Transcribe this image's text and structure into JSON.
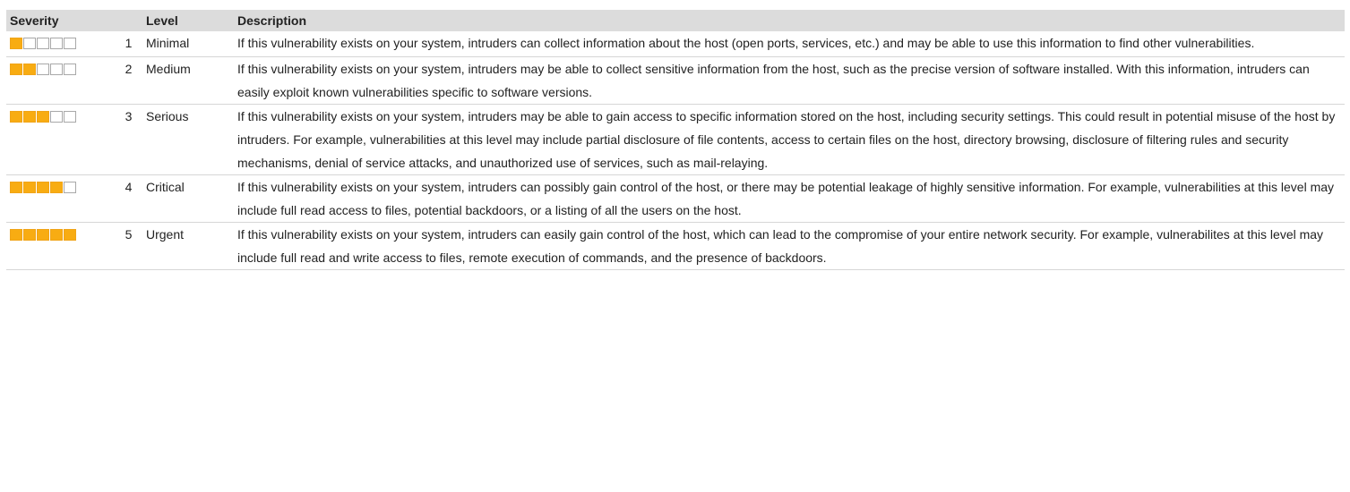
{
  "headers": {
    "severity": "Severity",
    "level": "Level",
    "description": "Description"
  },
  "colors": {
    "filled": "#f8ac12",
    "empty": "#ffffff",
    "header_bg": "#dcdcdc"
  },
  "rows": [
    {
      "number": "1",
      "level": "Minimal",
      "filled_boxes": 1,
      "total_boxes": 5,
      "description": "If this vulnerability exists on your system, intruders can collect information about the host (open ports, services, etc.) and may be able to use this information to find other vulnerabilities."
    },
    {
      "number": "2",
      "level": "Medium",
      "filled_boxes": 2,
      "total_boxes": 5,
      "description": "If this vulnerability exists on your system, intruders may be able to collect sensitive information from the host, such as the precise version of software installed. With this information, intruders can easily exploit known vulnerabilities specific to software versions."
    },
    {
      "number": "3",
      "level": "Serious",
      "filled_boxes": 3,
      "total_boxes": 5,
      "description": "If this vulnerability exists on your system, intruders may be able to gain access to specific information stored on the host, including security settings. This could result in potential misuse of the host by intruders. For example, vulnerabilities at this level may include partial disclosure of file contents, access to certain files on the host, directory browsing, disclosure of filtering rules and security mechanisms, denial of service attacks, and unauthorized use of services, such as mail-relaying."
    },
    {
      "number": "4",
      "level": "Critical",
      "filled_boxes": 4,
      "total_boxes": 5,
      "description": "If this vulnerability exists on your system, intruders can possibly gain control of the host, or there may be potential leakage of highly sensitive information. For example, vulnerabilities at this level may include full read access to files, potential backdoors, or a listing of all the users on the host."
    },
    {
      "number": "5",
      "level": "Urgent",
      "filled_boxes": 5,
      "total_boxes": 5,
      "description": "If this vulnerability exists on your system, intruders can easily gain control of the host, which can lead to the compromise of your entire network security. For example, vulnerabilites at this level may include full read and write access to files, remote execution of commands, and the presence of backdoors."
    }
  ]
}
